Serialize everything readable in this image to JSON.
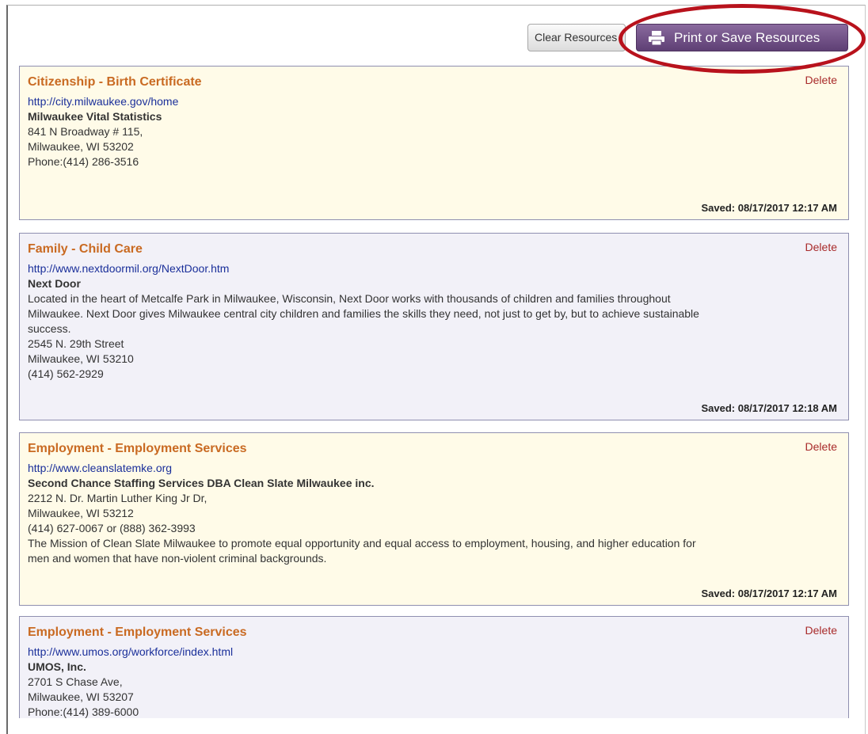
{
  "toolbar": {
    "clear_label": "Clear Resources",
    "print_label": "Print or Save Resources"
  },
  "resources": [
    {
      "title": "Citizenship - Birth Certificate",
      "delete_label": "Delete",
      "url": "http://city.milwaukee.gov/home",
      "org": "Milwaukee Vital Statistics",
      "lines": [
        "841 N Broadway # 115,",
        "Milwaukee, WI 53202",
        "Phone:(414) 286-3516"
      ],
      "saved": "Saved: 08/17/2017 12:17 AM"
    },
    {
      "title": "Family - Child Care",
      "delete_label": "Delete",
      "url": "http://www.nextdoormil.org/NextDoor.htm",
      "org": "Next Door",
      "lines": [
        "Located in the heart of Metcalfe Park in Milwaukee, Wisconsin, Next Door works with thousands of children and families throughout",
        "Milwaukee. Next Door gives Milwaukee central city children and families the skills they need, not just to get by, but to achieve sustainable",
        "success.",
        "2545 N. 29th Street",
        "Milwaukee, WI 53210",
        "(414) 562-2929"
      ],
      "saved": "Saved: 08/17/2017 12:18 AM"
    },
    {
      "title": "Employment - Employment Services",
      "delete_label": "Delete",
      "url": "http://www.cleanslatemke.org",
      "org": "Second Chance Staffing Services DBA Clean Slate Milwaukee inc.",
      "lines": [
        "2212 N. Dr. Martin Luther King Jr Dr,",
        "Milwaukee, WI 53212",
        "(414) 627-0067 or (888) 362-3993",
        "The Mission of Clean Slate Milwaukee to promote equal opportunity and equal access to employment, housing, and higher education for",
        "men and women that have non-violent criminal backgrounds."
      ],
      "saved": "Saved: 08/17/2017 12:17 AM"
    },
    {
      "title": "Employment - Employment Services",
      "delete_label": "Delete",
      "url": "http://www.umos.org/workforce/index.html",
      "org": "UMOS, Inc.",
      "lines": [
        "2701 S Chase Ave,",
        "Milwaukee, WI 53207",
        "Phone:(414) 389-6000"
      ]
    }
  ]
}
